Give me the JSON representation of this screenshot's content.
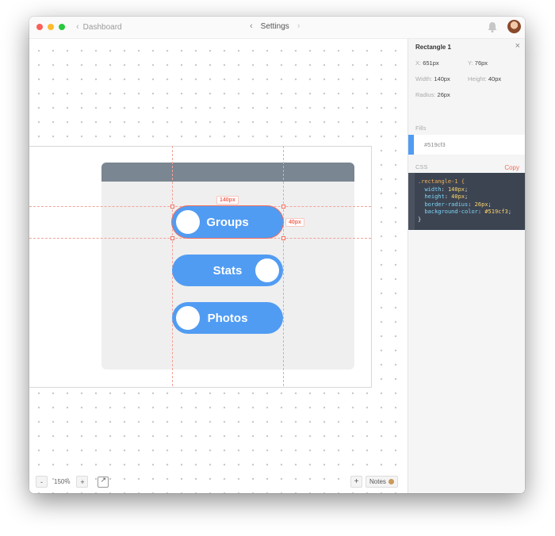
{
  "window": {
    "breadcrumb": "Dashboard",
    "title": "Settings"
  },
  "canvas": {
    "buttons": [
      {
        "label": "Groups",
        "knob": "left",
        "selected": true
      },
      {
        "label": "Stats",
        "knob": "right",
        "selected": false
      },
      {
        "label": "Photos",
        "knob": "left",
        "selected": false
      }
    ],
    "width_label": "140px",
    "height_label": "40px"
  },
  "bottom_bar": {
    "zoom_out": "-",
    "zoom_level": "150%",
    "zoom_in": "+",
    "add": "+",
    "notes": "Notes"
  },
  "inspector": {
    "layer_name": "Rectangle 1",
    "close": "×",
    "x_label": "X:",
    "x_value": "651px",
    "y_label": "Y:",
    "y_value": "76px",
    "width_label": "Width:",
    "width_value": "140px",
    "height_label": "Height:",
    "height_value": "40px",
    "radius_label": "Radius:",
    "radius_value": "26px",
    "fills_label": "Fills",
    "fill_hex": "#519cf3",
    "css_label": "CSS",
    "copy_label": "Copy",
    "css": {
      "selector": ".rectangle-1 {",
      "lines": [
        {
          "prop": "width",
          "val": "140px"
        },
        {
          "prop": "height",
          "val": "40px"
        },
        {
          "prop": "border-radius",
          "val": "26px"
        },
        {
          "prop": "background-color",
          "val": "#519cf3"
        }
      ],
      "close": "}"
    }
  },
  "colors": {
    "accent": "#519cf3",
    "selection": "#f26b5b",
    "card_header": "#7a8691"
  }
}
